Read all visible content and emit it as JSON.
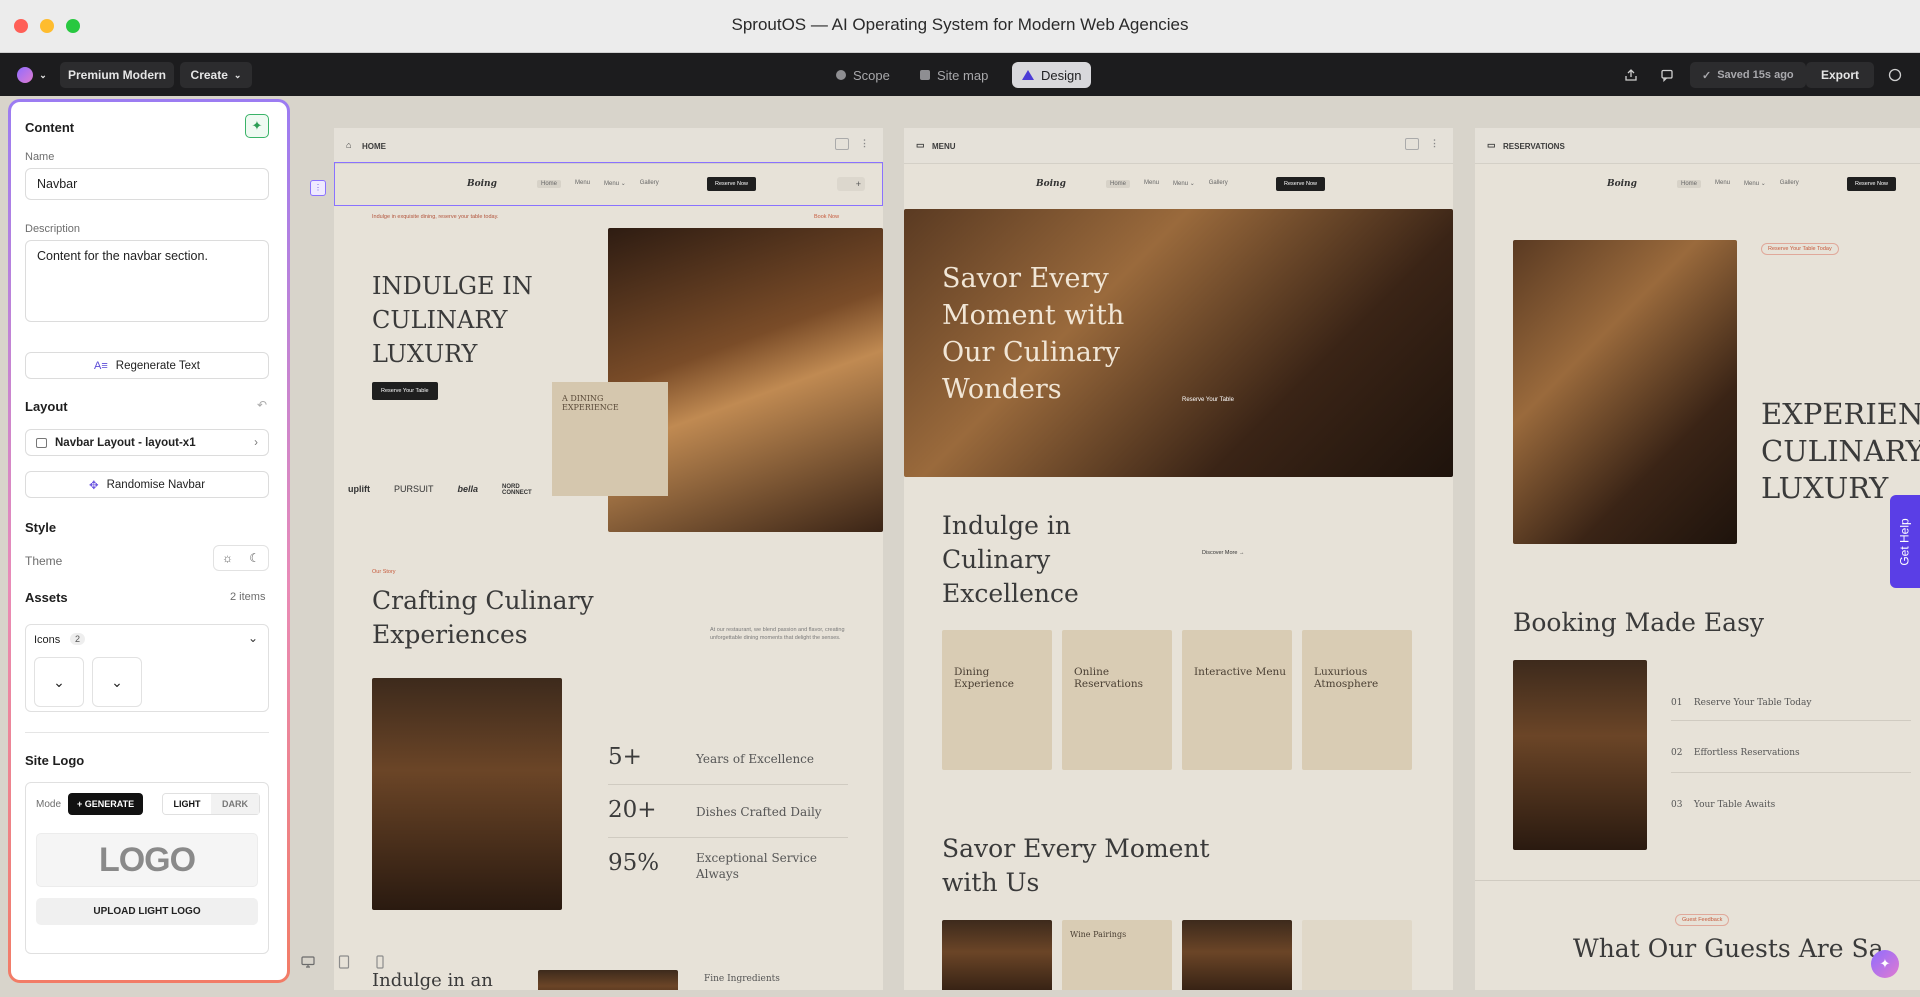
{
  "window": {
    "title": "SproutOS — AI Operating System for Modern Web Agencies"
  },
  "toolbar": {
    "project": "Premium Modern",
    "create": "Create",
    "modes": [
      "Scope",
      "Site map",
      "Design"
    ],
    "active_mode": "Design",
    "saved": "Saved 15s ago",
    "export": "Export"
  },
  "panel": {
    "content_heading": "Content",
    "name_label": "Name",
    "name_value": "Navbar",
    "description_label": "Description",
    "description_value": "Content for the navbar section.",
    "regenerate": "Regenerate Text",
    "layout_heading": "Layout",
    "layout_value": "Navbar Layout - layout-x1",
    "randomise": "Randomise Navbar",
    "style_heading": "Style",
    "theme_label": "Theme",
    "assets_heading": "Assets",
    "assets_count": "2 items",
    "icons_label": "Icons",
    "icons_count": "2",
    "site_logo_heading": "Site Logo",
    "mode_label": "Mode",
    "generate": "+ GENERATE",
    "light": "LIGHT",
    "dark": "DARK",
    "logo_placeholder": "LOGO",
    "upload": "UPLOAD LIGHT LOGO"
  },
  "frames": {
    "home": {
      "label": "HOME",
      "brand": "Boing",
      "nav": [
        "Home",
        "Menu",
        "Menu ⌄",
        "Gallery"
      ],
      "cta": "Reserve Now",
      "announcement": "Indulge in exquisite dining, reserve your table today.",
      "announcement_link": "Book Now",
      "hero_title": [
        "INDULGE IN",
        "CULINARY",
        "LUXURY"
      ],
      "hero_cta": "Reserve Your Table",
      "card_title": "A DINING EXPERIENCE",
      "logos": [
        "uplift",
        "PURSUIT",
        "bella",
        "NORD CONNECT"
      ],
      "section_kicker": "Our Story",
      "section_title": [
        "Crafting Culinary",
        "Experiences"
      ],
      "section_text": "At our restaurant, we blend passion and flavor, creating unforgettable dining moments that delight the senses.",
      "stats": [
        {
          "n": "5+",
          "l": "Years of Excellence"
        },
        {
          "n": "20+",
          "l": "Dishes Crafted Daily"
        },
        {
          "n": "95%",
          "l": "Exceptional Service Always"
        }
      ],
      "footer_title": "Indulge in an",
      "footer_label": "Fine Ingredients"
    },
    "menu": {
      "label": "MENU",
      "brand": "Boing",
      "nav": [
        "Home",
        "Menu",
        "Menu ⌄",
        "Gallery"
      ],
      "cta": "Reserve Now",
      "hero_title": [
        "Savor Every",
        "Moment with",
        "Our Culinary",
        "Wonders"
      ],
      "hero_cta": "Reserve Your Table",
      "section_title": [
        "Indulge in",
        "Culinary",
        "Excellence"
      ],
      "discover": "Discover More →",
      "cards": [
        "Dining Experience",
        "Online Reservations",
        "Interactive Menu",
        "Luxurious Atmosphere"
      ],
      "bottom_title": [
        "Savor Every Moment",
        "with Us"
      ],
      "bottom_card": "Wine Pairings"
    },
    "reservations": {
      "label": "RESERVATIONS",
      "brand": "Boing",
      "nav": [
        "Home",
        "Menu",
        "Menu ⌄",
        "Gallery"
      ],
      "cta": "Reserve Now",
      "badge": "Reserve Your Table Today",
      "hero_title": [
        "EXPERIEN",
        "CULINARY",
        "LUXURY"
      ],
      "booking_title": "Booking Made Easy",
      "steps": [
        {
          "n": "01",
          "t": "Reserve Your Table Today"
        },
        {
          "n": "02",
          "t": "Effortless Reservations"
        },
        {
          "n": "03",
          "t": "Your Table Awaits"
        }
      ],
      "feedback_badge": "Guest Feedback",
      "guests_title": "What Our Guests Are Sa"
    }
  },
  "get_help": "Get Help"
}
